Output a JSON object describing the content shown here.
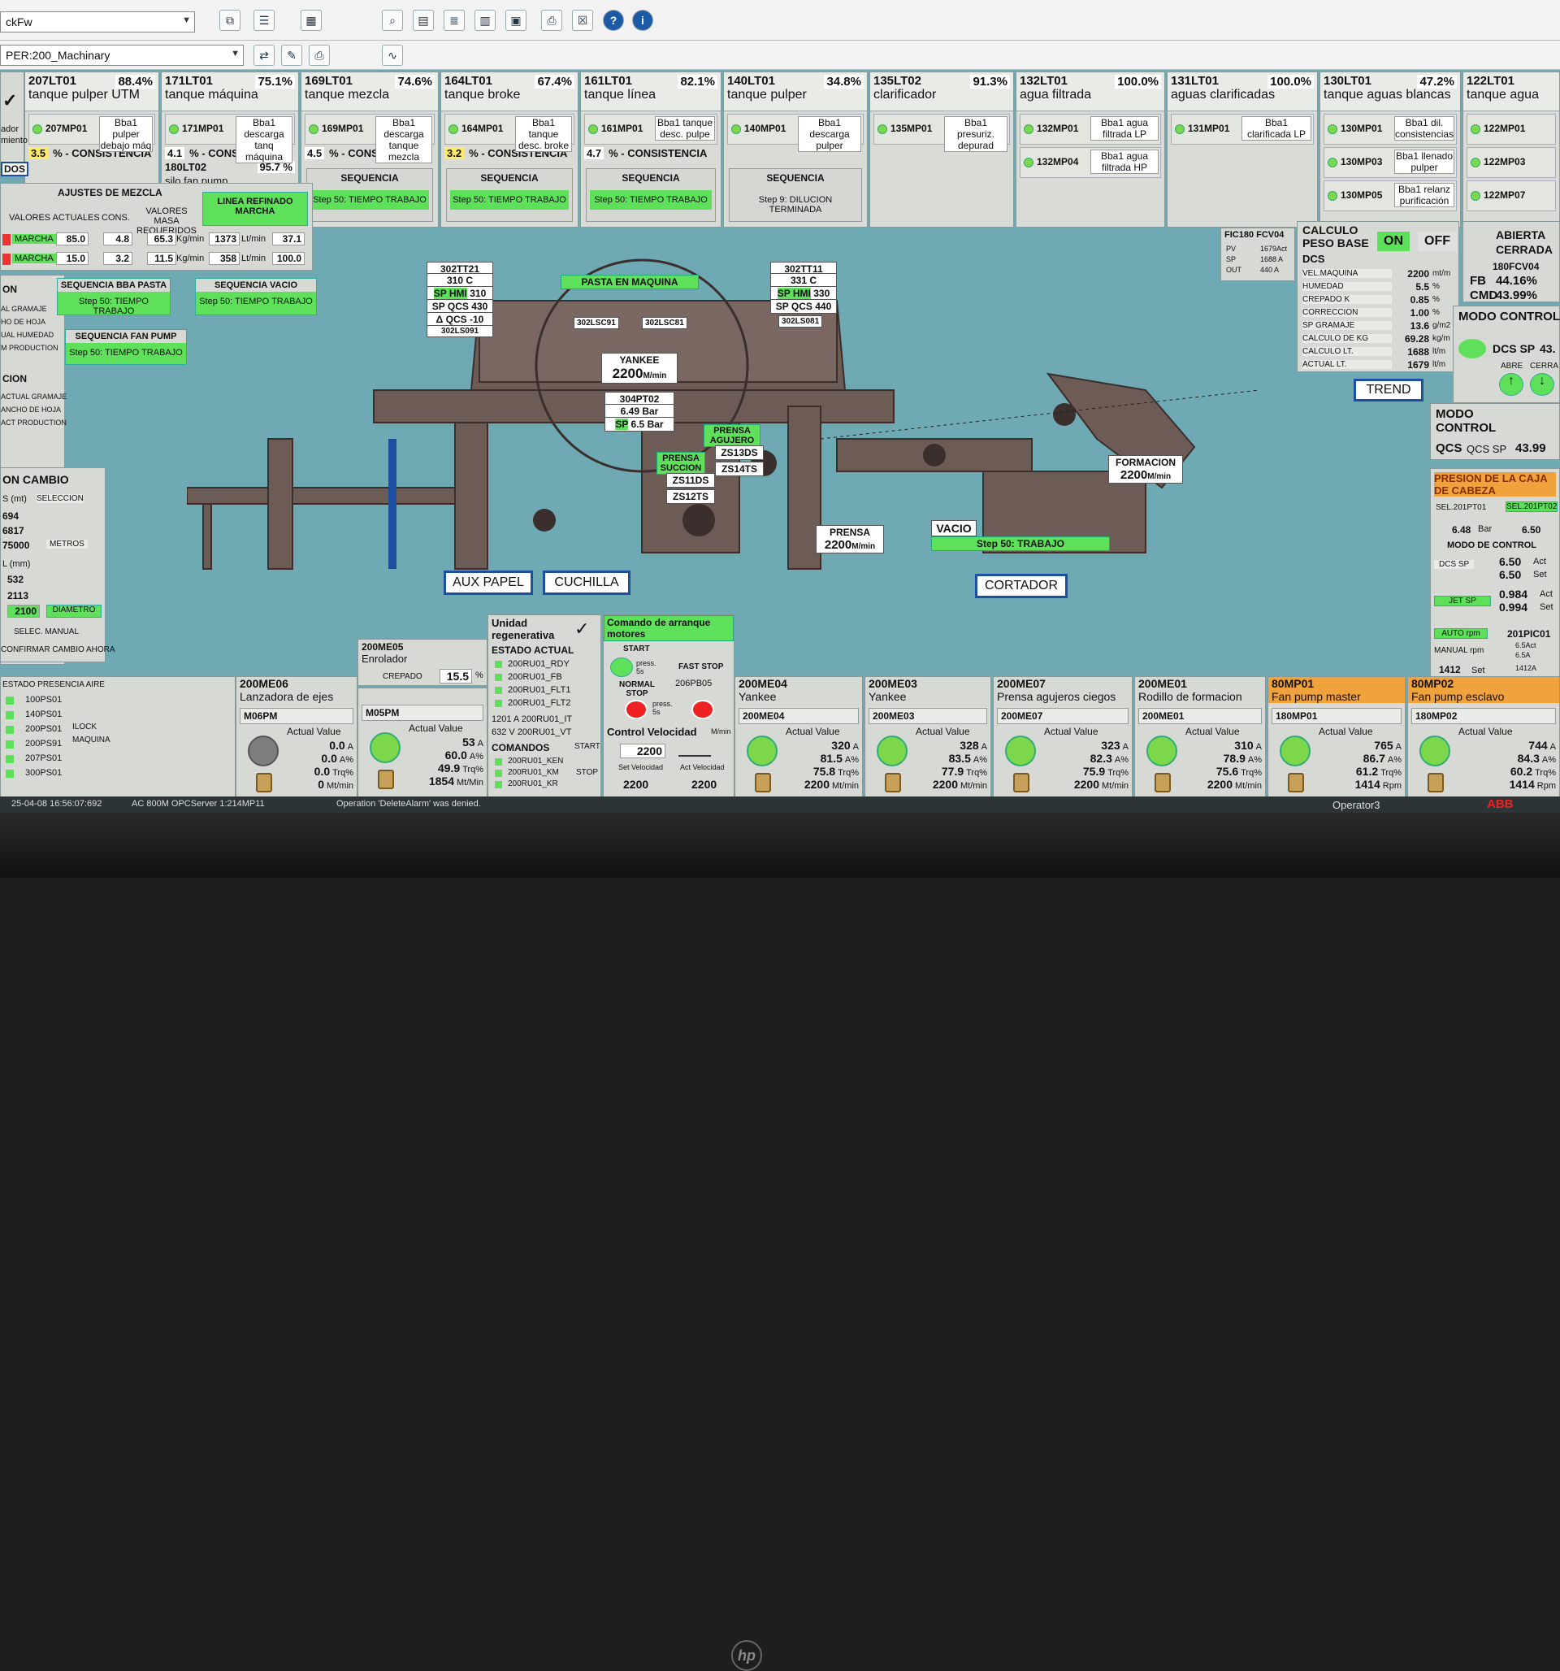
{
  "toolbar": {
    "combo1": "ckFw",
    "combo2": "PER:200_Machinary",
    "icons": [
      "copy-icon",
      "list-icon",
      "table-icon",
      "magnifier-icon",
      "report-icon",
      "doc-icon",
      "chart-icon",
      "print-icon",
      "close-icon",
      "help-icon",
      "info-icon"
    ]
  },
  "tanks": [
    {
      "tag": "207LT01",
      "pct": "88.4%",
      "name": "tanque pulper UTM",
      "pumps": [
        {
          "tag": "207MP01",
          "desc": "Bba1 pulper debajo máq"
        }
      ],
      "cons": "3.5",
      "cons_lbl": "% - CONSISTENCIA",
      "extra_tag": "",
      "extra_pct": ""
    },
    {
      "tag": "171LT01",
      "pct": "75.1%",
      "name": "tanque máquina",
      "pumps": [
        {
          "tag": "171MP01",
          "desc": "Bba1 descarga tanq máquina"
        }
      ],
      "cons": "4.1",
      "cons_lbl": "% - CONSISTENCIA",
      "extra_tag": "180LT02",
      "extra_pct": "95.7 %",
      "extra_name": "silo fan pump"
    },
    {
      "tag": "169LT01",
      "pct": "74.6%",
      "name": "tanque mezcla",
      "pumps": [
        {
          "tag": "169MP01",
          "desc": "Bba1 descarga tanque mezcla"
        }
      ],
      "cons": "4.5",
      "cons_lbl": "% - CONSISTENCIA",
      "seq_title": "SEQUENCIA",
      "seq_step": "Step 50: TIEMPO TRABAJO"
    },
    {
      "tag": "164LT01",
      "pct": "67.4%",
      "name": "tanque broke",
      "pumps": [
        {
          "tag": "164MP01",
          "desc": "Bba1 tanque desc. broke"
        }
      ],
      "cons": "3.2",
      "cons_lbl": "% - CONSISTENCIA",
      "seq_title": "SEQUENCIA",
      "seq_step": "Step 50: TIEMPO TRABAJO"
    },
    {
      "tag": "161LT01",
      "pct": "82.1%",
      "name": "tanque línea",
      "pumps": [
        {
          "tag": "161MP01",
          "desc": "Bba1 tanque desc. pulpe"
        }
      ],
      "cons": "4.7",
      "cons_lbl": "% - CONSISTENCIA",
      "seq_title": "SEQUENCIA",
      "seq_step": "Step 50: TIEMPO TRABAJO"
    },
    {
      "tag": "140LT01",
      "pct": "34.8%",
      "name": "tanque pulper",
      "pumps": [
        {
          "tag": "140MP01",
          "desc": "Bba1 descarga pulper"
        }
      ],
      "seq_title": "SEQUENCIA",
      "seq_step": "Step 9: DILUCION TERMINADA"
    },
    {
      "tag": "135LT02",
      "pct": "91.3%",
      "name": "clarificador",
      "pumps": [
        {
          "tag": "135MP01",
          "desc": "Bba1 presuriz. depurad"
        }
      ]
    },
    {
      "tag": "132LT01",
      "pct": "100.0%",
      "name": "agua filtrada",
      "pumps": [
        {
          "tag": "132MP01",
          "desc": "Bba1 agua filtrada LP"
        },
        {
          "tag": "132MP04",
          "desc": "Bba1 agua filtrada HP"
        }
      ]
    },
    {
      "tag": "131LT01",
      "pct": "100.0%",
      "name": "aguas clarificadas",
      "pumps": [
        {
          "tag": "131MP01",
          "desc": "Bba1 clarificada LP"
        }
      ]
    },
    {
      "tag": "130LT01",
      "pct": "47.2%",
      "name": "tanque aguas blancas",
      "pumps": [
        {
          "tag": "130MP01",
          "desc": "Bba1 dil. consistencias"
        },
        {
          "tag": "130MP03",
          "desc": "Bba1 llenado pulper"
        },
        {
          "tag": "130MP05",
          "desc": "Bba1 relanz purificación"
        }
      ]
    },
    {
      "tag": "122LT01",
      "pct": "",
      "name": "tanque agua",
      "pumps": [
        {
          "tag": "122MP01",
          "desc": ""
        },
        {
          "tag": "122MP03",
          "desc": ""
        },
        {
          "tag": "122MP07",
          "desc": ""
        }
      ]
    }
  ],
  "left": {
    "mix_title": "AJUSTES DE MEZCLA",
    "refinado": "LINEA REFINADO MARCHA",
    "col_actual": "VALORES ACTUALES",
    "col_cons": "CONS.",
    "col_masa": "VALORES MASA REQUERIDOS",
    "row1": {
      "status": "MARCHA",
      "pct": "85.0",
      "cons": "4.8",
      "kg": "65.3",
      "lt": "1373",
      "pct2": "37.1"
    },
    "row2": {
      "status": "MARCHA",
      "pct": "15.0",
      "cons": "3.2",
      "kg": "11.5",
      "lt": "358",
      "pct2": "100.0"
    },
    "unit_pct": "%",
    "unit_kg": "Kg/min",
    "unit_lt": "Lt/min",
    "seq_bba_title": "SEQUENCIA BBA PASTA",
    "seq_bba_step": "Step 50: TIEMPO TRABAJO",
    "seq_vacio_title": "SEQUENCIA VACIO",
    "seq_vacio_step": "Step 50: TIEMPO TRABAJO",
    "seq_fan_title": "SEQUENCIA FAN PUMP",
    "seq_fan_step": "Step 50: TIEMPO TRABAJO",
    "dos": "DOS",
    "on": "ON",
    "cion": "CION",
    "cambio": "ON CAMBIO",
    "sm": "S (mt)",
    "seleccion": "SELECCION",
    "v694": "694",
    "v6817": "6817",
    "v75000": "75000",
    "metros": "METROS",
    "lmm": "L (mm)",
    "v532": "532",
    "v2113": "2113",
    "v2100": "2100",
    "diametro": "DIAMETRO",
    "manual": "SELEC. MANUAL",
    "confirm": "CONFIRMAR CAMBIO AHORA",
    "presencia": "ESTADO PRESENCIA AIRE",
    "l1": "AL GRAMAJE",
    "l2": "HO DE HOJA",
    "l3": "UAL HUMEDAD",
    "l4": "M PRODUCTION",
    "l5": "ACTUAL GRAMAJE",
    "l6": "ANCHO DE HOJA",
    "l7": "ACT PRODUCTION",
    "dor": "ador",
    "miento": "miento",
    "ps": [
      "100PS01",
      "140PS01",
      "200PS01",
      "200PS91",
      "207PS01",
      "300PS01"
    ],
    "ilock": "ILOCK",
    "maquina": "MAQUINA"
  },
  "machine": {
    "pasta": "PASTA EN MAQUINA",
    "tt21": "302TT21",
    "tt21v": "310",
    "c": "C",
    "sphmi": "SP HMI",
    "sphmi_v": "310",
    "spqcs": "SP QCS",
    "spqcs_v": "430",
    "dqcs": "Δ QCS",
    "dqcs_v": "-10",
    "ls091": "302LS091",
    "tt11": "302TT11",
    "tt11v": "331",
    "sphmi2_v": "330",
    "spqcs2_v": "440",
    "ls081": "302LS081",
    "lsc91": "302LSC91",
    "lsc81": "302LSC81",
    "yankee": "YANKEE",
    "yankee_v": "2200",
    "mmin": "M/min",
    "pt02": "304PT02",
    "pt02_v": "6.49",
    "bar": "Bar",
    "sp": "SP",
    "sp_v": "6.5",
    "prensa_succ": "PRENSA SUCCION",
    "zs11": "ZS11DS",
    "zs12": "ZS12TS",
    "prensa_ag": "PRENSA AGUJERO",
    "zs13": "ZS13DS",
    "zs14": "ZS14TS",
    "formacion": "FORMACION",
    "formacion_v": "2200",
    "prensa": "PRENSA",
    "prensa_v": "2200",
    "vacio": "VACIO",
    "vacio_step": "Step 50: TRABAJO",
    "aux": "AUX PAPEL",
    "cuchilla": "CUCHILLA",
    "cortador": "CORTADOR"
  },
  "right": {
    "fic": "FIC180 FCV04",
    "pv": "PV",
    "pv_v": "1679Act",
    "sp": "SP",
    "sp_v": "1688 A",
    "out": "OUT",
    "out_v": "440 A",
    "calc": "CALCULO PESO BASE",
    "on": "ON",
    "off": "OFF",
    "dcs": "DCS",
    "rows": [
      {
        "l": "VEL.MAQUINA",
        "v": "2200",
        "u": "mt/m"
      },
      {
        "l": "HUMEDAD",
        "v": "5.5",
        "u": "%"
      },
      {
        "l": "CREPADO K",
        "v": "0.85",
        "u": "%"
      },
      {
        "l": "CORRECCION",
        "v": "1.00",
        "u": "%"
      },
      {
        "l": "SP GRAMAJE",
        "v": "13.6",
        "u": "g/m2"
      },
      {
        "l": "CALCULO DE KG",
        "v": "69.28",
        "u": "kg/m"
      },
      {
        "l": "CALCULO LT.",
        "v": "1688",
        "u": "lt/m"
      },
      {
        "l": "ACTUAL LT.",
        "v": "1679",
        "u": "lt/m"
      }
    ],
    "abierta": "ABIERTA",
    "cerrada": "CERRADA",
    "fcv": "180FCV04",
    "fb": "FB",
    "fb_v": "44.16%",
    "cmd": "CMD",
    "cmd_v": "43.99%",
    "modo": "MODO CONTROL",
    "dcssp": "DCS SP",
    "dcssp_v": "43.",
    "abre": "ABRE",
    "cierra": "CERRA",
    "trend": "TREND",
    "modo2": "MODO CONTROL",
    "qcs": "QCS",
    "qcssp": "QCS SP",
    "qcssp_v": "43.99",
    "presion": "PRESION DE LA CAJA DE CABEZA",
    "sel1": "SEL.201PT01",
    "sel2": "SEL.201PT02",
    "p1": "6.48",
    "p2": "6.50",
    "bar": "Bar",
    "modo3": "MODO DE CONTROL",
    "dcssp2": "DCS SP",
    "a1": "6.50",
    "a2": "6.50",
    "act": "Act",
    "set": "Set",
    "jetsp": "JET SP",
    "j1": "0.984",
    "j2": "0.994",
    "auto": "AUTO rpm",
    "manual": "MANUAL rpm",
    "pic": "201PIC01",
    "pv2": "6.5Act",
    "sp2": "6.5A",
    "v1412": "1412",
    "out2": "1412A"
  },
  "motors": [
    {
      "tag": "200ME06",
      "name": "Lanzadora de ejes",
      "sub": "M06PM",
      "a": "0.0",
      "b": "0.0",
      "c": "0.0",
      "d": "0",
      "grey": true,
      "u3": "Trq%",
      "u4": "Mt/min"
    },
    {
      "tag": "",
      "name": "",
      "sub": "M05PM",
      "a": "53",
      "b": "60.0",
      "c": "49.9",
      "d": "1854",
      "u3": "Trq%",
      "u4": "Mt/Min"
    },
    {
      "tag": "200ME04",
      "name": "Yankee",
      "sub": "200ME04",
      "a": "320",
      "b": "81.5",
      "c": "75.8",
      "d": "2200",
      "u3": "Trq%",
      "u4": "Mt/min"
    },
    {
      "tag": "200ME03",
      "name": "Yankee",
      "sub": "200ME03",
      "a": "328",
      "b": "83.5",
      "c": "77.9",
      "d": "2200",
      "u3": "Trq%",
      "u4": "Mt/min"
    },
    {
      "tag": "200ME07",
      "name": "Prensa agujeros ciegos",
      "sub": "200ME07",
      "a": "323",
      "b": "82.3",
      "c": "75.9",
      "d": "2200",
      "u3": "Trq%",
      "u4": "Mt/min"
    },
    {
      "tag": "200ME01",
      "name": "Rodillo de formacion",
      "sub": "200ME01",
      "a": "310",
      "b": "78.9",
      "c": "75.6",
      "d": "2200",
      "u3": "Trq%",
      "u4": "Mt/min"
    },
    {
      "tag": "80MP01",
      "name": "Fan pump master",
      "sub": "180MP01",
      "a": "765",
      "b": "86.7",
      "c": "61.2",
      "d": "1414",
      "orange": true,
      "u3": "Trq%",
      "u4": "Rpm"
    },
    {
      "tag": "80MP02",
      "name": "Fan pump esclavo",
      "sub": "180MP02",
      "a": "744",
      "b": "84.3",
      "c": "60.2",
      "d": "1414",
      "orange": true,
      "u3": "Trq%",
      "u4": "Rpm"
    }
  ],
  "enrolador": {
    "tag": "200ME05",
    "name": "Enrolador",
    "crepado": "CREPADO",
    "crepado_v": "15.5",
    "pct": "%"
  },
  "actual_value": "Actual Value",
  "regen": {
    "title": "Unidad regenerativa",
    "estado": "ESTADO ACTUAL",
    "items": [
      "200RU01_RDY",
      "200RU01_FB",
      "200RU01_FLT1",
      "200RU01_FLT2"
    ],
    "amp": "1201 A",
    "it": "200RU01_IT",
    "v": "632 V",
    "vt": "200RU01_VT",
    "comandos": "COMANDOS",
    "start": "START",
    "stop": "STOP",
    "cmds": [
      "200RU01_KEN",
      "200RU01_KM",
      "200RU01_KR"
    ]
  },
  "arranque": {
    "title": "Comando de arranque motores",
    "start": "START",
    "press": "press. 5s",
    "fast": "FAST STOP",
    "normal": "NORMAL STOP",
    "pb": "206PB05",
    "ctrl": "Control Velocidad",
    "mmin": "M/min",
    "vel": "2200",
    "setv": "Set Velocidad",
    "actv": "Act Velocidad",
    "s1": "2200",
    "s2": "2200"
  },
  "status": {
    "time": "25-04-08 16:56:07:692",
    "server": "AC 800M OPCServer 1:214MP11",
    "msg": "Operation 'DeleteAlarm' was denied.",
    "operator": "Operator3",
    "abb": "ABB"
  }
}
